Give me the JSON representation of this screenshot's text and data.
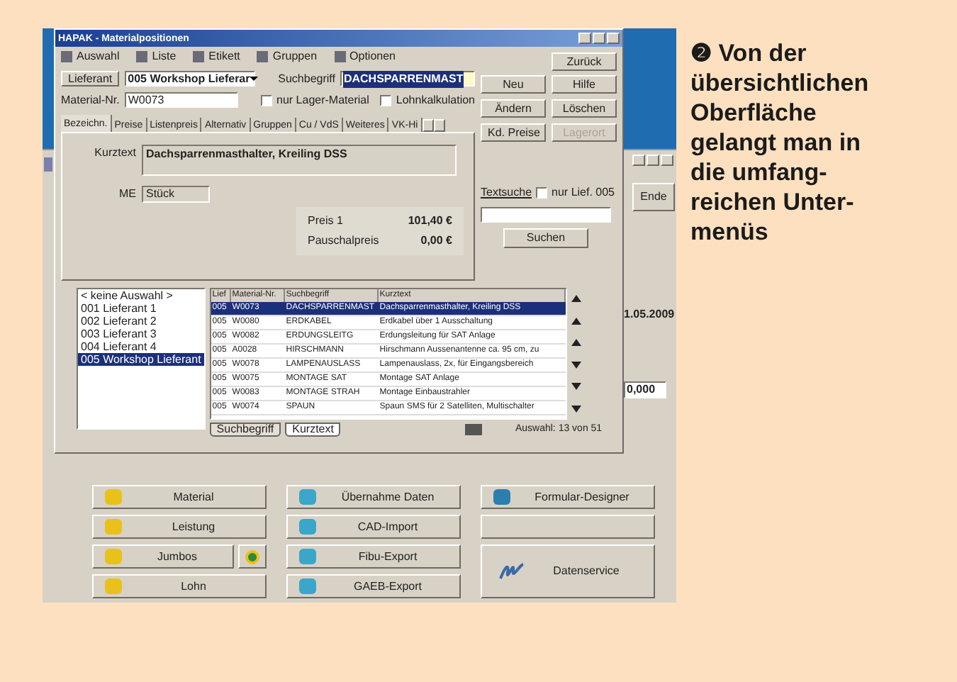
{
  "front_window": {
    "title": "HAPAK - Materialpositionen",
    "toolbar": [
      "Auswahl",
      "Liste",
      "Etikett",
      "Gruppen",
      "Optionen"
    ],
    "back_button": "Zurück",
    "supplier_button": "Lieferant",
    "supplier_combo": "005 Workshop Lieferar",
    "search_term_label": "Suchbegriff",
    "search_term": "DACHSPARRENMAST",
    "material_no_label": "Material-Nr.",
    "material_no": "W0073",
    "checkboxes": [
      {
        "label": "nur Lager-Material",
        "checked": false
      },
      {
        "label": "Lohnkalkulation",
        "checked": false
      }
    ],
    "side_buttons": [
      {
        "label": "Neu",
        "disabled": false
      },
      {
        "label": "Hilfe",
        "disabled": false
      },
      {
        "label": "Ändern",
        "disabled": false
      },
      {
        "label": "Löschen",
        "disabled": false
      },
      {
        "label": "Kd. Preise",
        "disabled": false
      },
      {
        "label": "Lagerort",
        "disabled": true
      }
    ],
    "tabs": [
      {
        "label": "Bezeichn.",
        "selected": true
      },
      {
        "label": "Preise",
        "selected": false
      },
      {
        "label": "Listenpreis",
        "selected": false
      },
      {
        "label": "Alternativ",
        "selected": false
      },
      {
        "label": "Gruppen",
        "selected": false
      },
      {
        "label": "Cu / VdS",
        "selected": false
      },
      {
        "label": "Weiteres",
        "selected": false
      },
      {
        "label": "VK-Hi",
        "selected": false
      }
    ],
    "short_text_label": "Kurztext",
    "short_text": "Dachsparrenmasthalter, Kreiling DSS",
    "unit_label": "ME",
    "unit": "Stück",
    "prices": [
      {
        "label": "Preis 1",
        "value": "101,40 €"
      },
      {
        "label": "Pauschalpreis",
        "value": "0,00 €"
      }
    ],
    "text_search_label": "Textsuche",
    "text_search_checkbox": {
      "label": "nur Lief. 005",
      "checked": false
    },
    "search_button": "Suchen",
    "suppliers": [
      {
        "label": "< keine Auswahl >",
        "selected": false
      },
      {
        "label": "001 Lieferant 1",
        "selected": false
      },
      {
        "label": "002 Lieferant 2",
        "selected": false
      },
      {
        "label": "003 Lieferant 3",
        "selected": false
      },
      {
        "label": "004 Lieferant 4",
        "selected": false
      },
      {
        "label": "005 Workshop Lieferant",
        "selected": true
      }
    ],
    "table": {
      "columns": [
        "Lief",
        "Material-Nr.",
        "Suchbegriff",
        "Kurztext"
      ],
      "rows": [
        {
          "cells": [
            "005",
            "W0073",
            "DACHSPARRENMAST",
            "Dachsparrenmasthalter, Kreiling DSS"
          ],
          "selected": true
        },
        {
          "cells": [
            "005",
            "W0080",
            "ERDKABEL",
            "Erdkabel über 1 Ausschaltung"
          ],
          "selected": false
        },
        {
          "cells": [
            "005",
            "W0082",
            "ERDUNGSLEITG",
            "Erdungsleitung für SAT Anlage"
          ],
          "selected": false
        },
        {
          "cells": [
            "005",
            "A0028",
            "HIRSCHMANN",
            "Hirschmann Aussenantenne ca. 95 cm, zu"
          ],
          "selected": false
        },
        {
          "cells": [
            "005",
            "W0078",
            "LAMPENAUSLASS",
            "Lampenauslass, 2x, für Eingangsbereich"
          ],
          "selected": false
        },
        {
          "cells": [
            "005",
            "W0075",
            "MONTAGE SAT",
            "Montage SAT Anlage"
          ],
          "selected": false
        },
        {
          "cells": [
            "005",
            "W0083",
            "MONTAGE STRAH",
            "Montage Einbaustrahler"
          ],
          "selected": false
        },
        {
          "cells": [
            "005",
            "W0074",
            "SPAUN",
            "Spaun SMS für 2 Satelliten, Multischalter"
          ],
          "selected": false
        }
      ]
    },
    "bottom_tabs": [
      {
        "label": "Suchbegriff",
        "selected": true
      },
      {
        "label": "Kurztext",
        "selected": false
      }
    ],
    "count": "Auswahl: 13 von 51"
  },
  "back_window": {
    "end_button": "Ende",
    "date": "1.05.2009",
    "amount": "0,000",
    "buttons": [
      {
        "label": "Material",
        "kind": "normal"
      },
      {
        "label": "Übernahme Daten",
        "kind": "normal"
      },
      {
        "label": "Formular-Designer",
        "kind": "normal"
      },
      {
        "label": "Leistung",
        "kind": "normal"
      },
      {
        "label": "CAD-Import",
        "kind": "normal"
      },
      {
        "kind": "disabled"
      },
      {
        "label": "Jumbos",
        "kind": "split"
      },
      {
        "label": "Fibu-Export",
        "kind": "normal"
      },
      {
        "label": "Datenservice",
        "kind": "tall"
      },
      {
        "label": "Lohn",
        "kind": "normal"
      },
      {
        "label": "GAEB-Export",
        "kind": "normal"
      }
    ]
  },
  "caption": {
    "number": "❷",
    "lines": [
      "Von der",
      "übersichtlichen",
      "Oberfläche",
      "gelangt man in",
      "die umfang-",
      "reichen Unter-",
      "menüs"
    ]
  }
}
